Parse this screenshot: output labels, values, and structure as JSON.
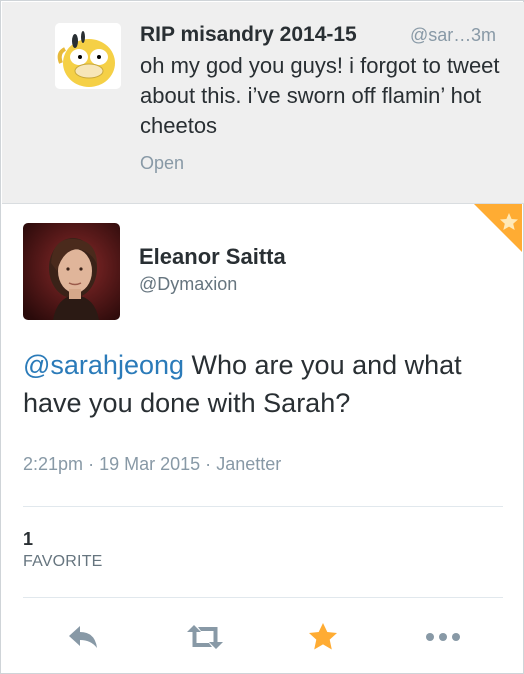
{
  "context_tweet": {
    "name": "RIP misandry 2014-15",
    "handle": "@sar…",
    "time": "3m",
    "text": "oh my god you guys! i forgot to tweet about this. i’ve sworn off flamin’ hot cheetos",
    "open_label": "Open",
    "avatar_icon": "psyduck-avatar"
  },
  "tweet": {
    "name": "Eleanor Saitta",
    "handle": "@Dymaxion",
    "mention": "@sarahjeong",
    "text": " Who are you and what have you done with Sarah?",
    "time": "2:21pm",
    "date": "19 Mar 2015",
    "client": "Janetter",
    "separator": "·",
    "avatar_icon": "profile-photo"
  },
  "stats": {
    "favorites_count": "1",
    "favorites_label": "FAVORITE"
  },
  "actions": [
    {
      "name": "reply",
      "icon": "reply-icon"
    },
    {
      "name": "retweet",
      "icon": "retweet-icon"
    },
    {
      "name": "favorite",
      "icon": "star-icon",
      "active": true
    },
    {
      "name": "more",
      "icon": "more-icon"
    }
  ],
  "colors": {
    "accent_favorite": "#ffac33",
    "link": "#2b7bb9",
    "muted": "#8899a6",
    "context_bg": "#efefef"
  }
}
